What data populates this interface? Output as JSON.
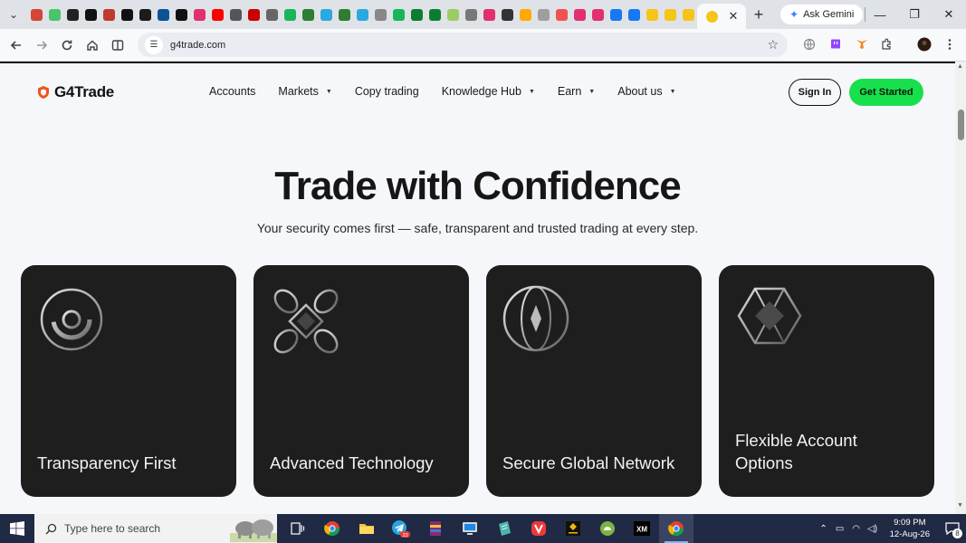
{
  "browser": {
    "favicon_colors": [
      "#d44638",
      "#49c46b",
      "#222222",
      "#111111",
      "#c0392b",
      "#111111",
      "#1b1b1b",
      "#0b5394",
      "#111111",
      "#e1306c",
      "#ff0000",
      "#555555",
      "#cc0000",
      "#666666",
      "#19b55a",
      "#2e7d32",
      "#29a9e0",
      "#2e7d32",
      "#29a9e0",
      "#888888",
      "#19b55a",
      "#0a7d33",
      "#0a7d33",
      "#9ccc65",
      "#777777",
      "#e1306c",
      "#333333",
      "#ffaa00",
      "#9e9e9e",
      "#ef5350",
      "#e1306c",
      "#e1306c",
      "#1877f2",
      "#1877f2",
      "#f5c518",
      "#f5c518",
      "#f5c518"
    ],
    "active_tab_close": "✕",
    "new_tab": "+",
    "gemini_label": "Ask Gemini",
    "url": "g4trade.com"
  },
  "site": {
    "logo_text": "G4Trade",
    "nav": [
      {
        "label": "Accounts",
        "dropdown": false
      },
      {
        "label": "Markets",
        "dropdown": true
      },
      {
        "label": "Copy trading",
        "dropdown": false
      },
      {
        "label": "Knowledge Hub",
        "dropdown": true
      },
      {
        "label": "Earn",
        "dropdown": true
      },
      {
        "label": "About us",
        "dropdown": true
      }
    ],
    "signin_label": "Sign In",
    "get_started_label": "Get Started",
    "accent_color": "#18e04d",
    "brand_color": "#f0541e"
  },
  "hero": {
    "title": "Trade with Confidence",
    "subtitle": "Your security comes first — safe, transparent and trusted trading at every step."
  },
  "cards": [
    {
      "title": "Transparency First",
      "icon": "transparency-icon"
    },
    {
      "title": "Advanced Technology",
      "icon": "technology-icon"
    },
    {
      "title": "Secure Global Network",
      "icon": "globe-icon"
    },
    {
      "title": "Flexible Account Options",
      "icon": "flexible-icon"
    }
  ],
  "taskbar": {
    "search_placeholder": "Type here to search",
    "time": "9:09 PM",
    "date": "12-Aug-26",
    "notification_count": "8",
    "telegram_badge": "23"
  }
}
